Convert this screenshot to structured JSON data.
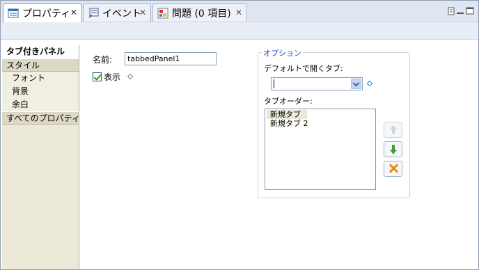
{
  "tabs": [
    {
      "label": "プロパティ",
      "icon": "properties-table-icon",
      "active": true
    },
    {
      "label": "イベント",
      "icon": "events-icon",
      "active": false
    },
    {
      "label": "問題 (0 項目)",
      "icon": "problems-icon",
      "active": false
    }
  ],
  "leftnav": {
    "items": [
      {
        "label": "タブ付きパネル",
        "kind": "selected"
      },
      {
        "label": "スタイル",
        "kind": "category"
      },
      {
        "label": "フォント",
        "kind": "sub"
      },
      {
        "label": "背景",
        "kind": "sub"
      },
      {
        "label": "余白",
        "kind": "sub"
      },
      {
        "label": "すべてのプロパティ",
        "kind": "category"
      }
    ]
  },
  "form": {
    "name_label": "名前:",
    "name_value": "tabbedPanel1",
    "show_label": "表示",
    "show_checked": true
  },
  "options": {
    "title": "オプション",
    "default_tab_label": "デフォルトで開くタブ:",
    "default_tab_value": "",
    "tab_order_label": "タブオーダー:",
    "tab_order_items": [
      "新規タブ",
      "新規タブ 2"
    ]
  },
  "colors": {
    "tab_strip": "#dfe6f1",
    "nav_background": "#ece9d8",
    "group_title": "#1c4fb3",
    "move_down_arrow": "#3e9f30",
    "delete_x": "#e08c1a"
  }
}
